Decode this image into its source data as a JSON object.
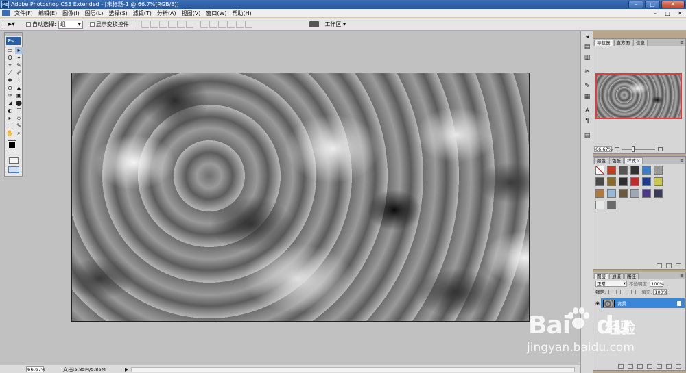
{
  "window": {
    "title": "Adobe Photoshop CS3 Extended - [未标题-1 @ 66.7%(RGB/8)]",
    "app_icon": "Ps",
    "controls": [
      "–",
      "□",
      "✕"
    ]
  },
  "menubar": {
    "items": [
      "文件(F)",
      "编辑(E)",
      "图像(I)",
      "图层(L)",
      "选择(S)",
      "滤镜(T)",
      "分析(A)",
      "视图(V)",
      "窗口(W)",
      "帮助(H)"
    ],
    "doc_controls": [
      "–",
      "□",
      "✕"
    ]
  },
  "options": {
    "auto_select_label": "自动选择:",
    "auto_select_value": "组",
    "show_transform_label": "显示变换控件",
    "workspace_label": "工作区 ▾"
  },
  "toolbox": {
    "logo": "Ps",
    "tools": [
      "▭",
      "▸",
      "ʘ",
      "✦",
      "⌗",
      "✎",
      "⟋",
      "✐",
      "✚",
      "⌇",
      "⊙",
      "▲",
      "✑",
      "▣",
      "◢",
      "⬤",
      "◐",
      "T",
      "▸",
      "◇",
      "▭",
      "✎",
      "✋",
      "⌕"
    ]
  },
  "status": {
    "zoom": "66.67%",
    "doc_info": "文档:5.85M/5.85M"
  },
  "navigator_panel": {
    "tabs": [
      "导航器",
      "直方图",
      "信息"
    ],
    "zoom": "66.67%"
  },
  "styles_panel": {
    "tabs": [
      "颜色",
      "色板",
      "样式"
    ],
    "swatch_colors": [
      "#f4f4f4",
      "#c73c1c",
      "#555555",
      "#333333",
      "#3a7ec8",
      "#9a9a9a",
      "#4a4a4a",
      "#8a6a2a",
      "#2e2e2e",
      "#c42a2a",
      "#1e3a8a",
      "#c8c84a",
      "#b07a3a",
      "#98b8d8",
      "#6a5a3a",
      "#9ea8b4",
      "#4a3a8a",
      "#3a3a5a",
      "#e8e8e8",
      "#6a6a6a"
    ]
  },
  "layers_panel": {
    "tabs": [
      "图层",
      "通道",
      "路径"
    ],
    "blend_mode": "正常",
    "opacity_label": "不透明度:",
    "opacity_value": "100%",
    "lock_label": "锁定:",
    "fill_label": "填充:",
    "fill_value": "100%",
    "layer_name": "背景"
  },
  "watermark": {
    "brand": "Bai",
    "brand_suffix": "du",
    "cn": "经验",
    "url": "jingyan.baidu.com"
  }
}
